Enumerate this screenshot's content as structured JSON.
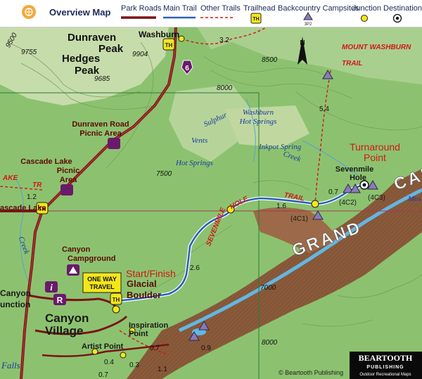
{
  "legend": {
    "overview_map": "Overview Map",
    "park_roads": "Park Roads",
    "main_trail": "Main Trail",
    "other_trails": "Other Trails",
    "trailhead": "Trailhead",
    "backcountry_campsites": "Backcountry Campsites",
    "campsite_code": "3P2",
    "junction": "Junction",
    "destination": "Destination",
    "trailhead_badge": "TH"
  },
  "peaks": {
    "dunraven_line1": "Dunraven",
    "dunraven_line2": "Peak",
    "dunraven_elev": "9904",
    "hedges_line1": "Hedges",
    "hedges_line2": "Peak",
    "hedges_elev": "9685",
    "west_elev": "9755",
    "washburn": "Washburn"
  },
  "places": {
    "dunraven_picnic_line1": "Dunraven Road",
    "dunraven_picnic_line2": "Picnic Area",
    "cascade_picnic_line1": "Cascade Lake",
    "cascade_picnic_line2": "Picnic",
    "cascade_picnic_line3": "Area",
    "cascade_lake": "ascade Lake",
    "campground_line1": "Canyon",
    "campground_line2": "Campground",
    "canyon_junction_line1": "Canyon",
    "canyon_junction_line2": "unction",
    "canyon_village_line1": "Canyon",
    "canyon_village_line2": "Village",
    "inspiration_line1": "Inspiration",
    "inspiration_line2": "Point",
    "artist_point": "Artist Point",
    "glacial_line1": "Glacial",
    "glacial_line2": "Boulder",
    "sevenmile_line1": "Sevenmile",
    "sevenmile_line2": "Hole",
    "falls": "Falls"
  },
  "features": {
    "washburn_springs_line1": "Washburn",
    "washburn_springs_line2": "Hot Springs",
    "inkpot": "Inkpot Spring",
    "sulphur": "Sulphur",
    "vents": "Vents",
    "hot_springs": "Hot Springs",
    "creek": "Creek",
    "creek_west": "Creek",
    "lake_trail_left": "AKE",
    "lake_trail_right": "TR"
  },
  "trails": {
    "mount_washburn_line1": "MOUNT WASHBURN",
    "mount_washburn_line2": "TRAIL",
    "sevenmile": "SEVENMILE",
    "hole": "HOLE",
    "trail": "TRAIL"
  },
  "labels": {
    "start_finish": "Start/Finish",
    "one_way_line1": "ONE WAY",
    "one_way_line2": "TRAVEL",
    "turnaround_line1": "Turnaround",
    "turnaround_line2": "Point",
    "grand": "GRAND",
    "can": "CAN",
    "mos": "Mos",
    "route_6": "6",
    "info_i": "i",
    "ranger_r": "R"
  },
  "distances": [
    "3.2",
    "5.4",
    "1.6",
    "0.7",
    "2.6",
    "1.2",
    "0.9",
    "0.7",
    "0.4",
    "0.3",
    "1.1",
    "0.7"
  ],
  "elevations": [
    "9500",
    "8500",
    "8000",
    "7500",
    "7000",
    "8000"
  ],
  "campsites": [
    "(4C2)",
    "(4C3)",
    "(4C1)"
  ],
  "publisher": {
    "name": "BEARTOOTH",
    "sub": "PUBLISHING",
    "tagline": "Outdoor Recreational Maps",
    "credit": "© Beartooth Publishing"
  },
  "colors": {
    "forest": "#8cc26f",
    "meadow": "#c9d9a3",
    "canyon": "#8a5a3a",
    "river": "#63b7e3",
    "main_trail": "#2a62b8",
    "park_road": "#7a1416",
    "other_trail": "#d01818",
    "junction": "#f5e61a"
  }
}
